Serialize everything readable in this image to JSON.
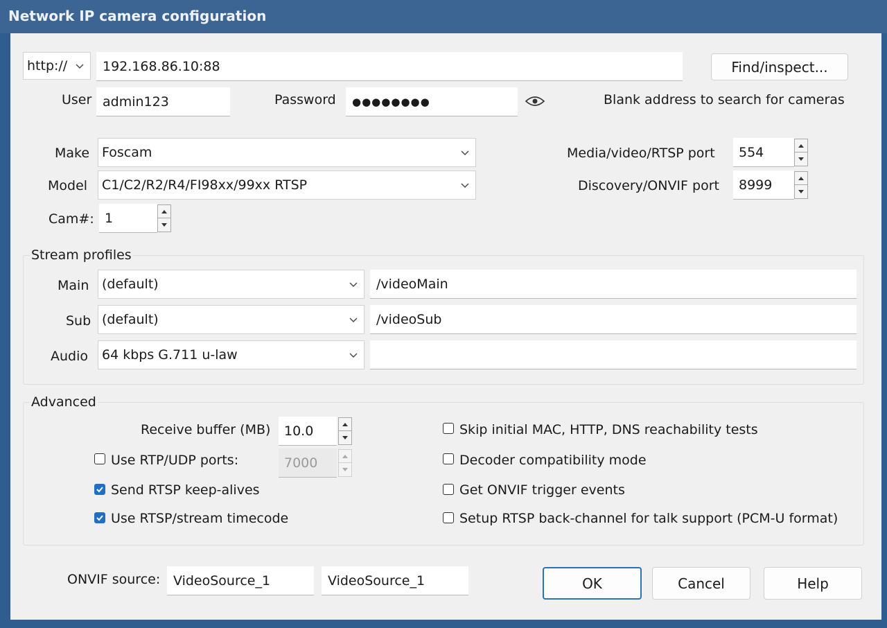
{
  "window": {
    "title": "Network IP camera configuration"
  },
  "address": {
    "scheme": "http://",
    "value": "192.168.86.10:88",
    "find_button": "Find/inspect..."
  },
  "credentials": {
    "user_label": "User",
    "user_value": "admin123",
    "password_label": "Password",
    "password_mask": "●●●●●●●●",
    "hint": "Blank address to search for cameras"
  },
  "device": {
    "make_label": "Make",
    "make_value": "Foscam",
    "model_label": "Model",
    "model_value": "C1/C2/R2/R4/FI98xx/99xx RTSP",
    "cam_label": "Cam#:",
    "cam_value": "1",
    "media_port_label": "Media/video/RTSP port",
    "media_port_value": "554",
    "discovery_port_label": "Discovery/ONVIF port",
    "discovery_port_value": "8999"
  },
  "stream_profiles": {
    "title": "Stream profiles",
    "main_label": "Main",
    "main_profile": "(default)",
    "main_path": "/videoMain",
    "sub_label": "Sub",
    "sub_profile": "(default)",
    "sub_path": "/videoSub",
    "audio_label": "Audio",
    "audio_profile": "64 kbps G.711 u-law",
    "audio_path": ""
  },
  "advanced": {
    "title": "Advanced",
    "receive_buffer_label": "Receive buffer (MB)",
    "receive_buffer_value": "10.0",
    "rtp_udp_label": "Use RTP/UDP ports:",
    "rtp_udp_checked": false,
    "rtp_udp_value": "7000",
    "keepalive_label": "Send RTSP keep-alives",
    "keepalive_checked": true,
    "timecode_label": "Use RTSP/stream timecode",
    "timecode_checked": true,
    "skip_tests_label": "Skip initial MAC, HTTP, DNS reachability tests",
    "skip_tests_checked": false,
    "decoder_compat_label": "Decoder compatibility mode",
    "decoder_compat_checked": false,
    "onvif_events_label": "Get ONVIF trigger events",
    "onvif_events_checked": false,
    "backchannel_label": "Setup RTSP back-channel for talk support (PCM-U format)",
    "backchannel_checked": false
  },
  "onvif": {
    "label": "ONVIF source:",
    "source1": "VideoSource_1",
    "source2": "VideoSource_1"
  },
  "buttons": {
    "ok": "OK",
    "cancel": "Cancel",
    "help": "Help"
  },
  "colors": {
    "titlebar": "#3c6593",
    "accent": "#1f6fc6",
    "dialog_bg": "#f0f0f0"
  }
}
